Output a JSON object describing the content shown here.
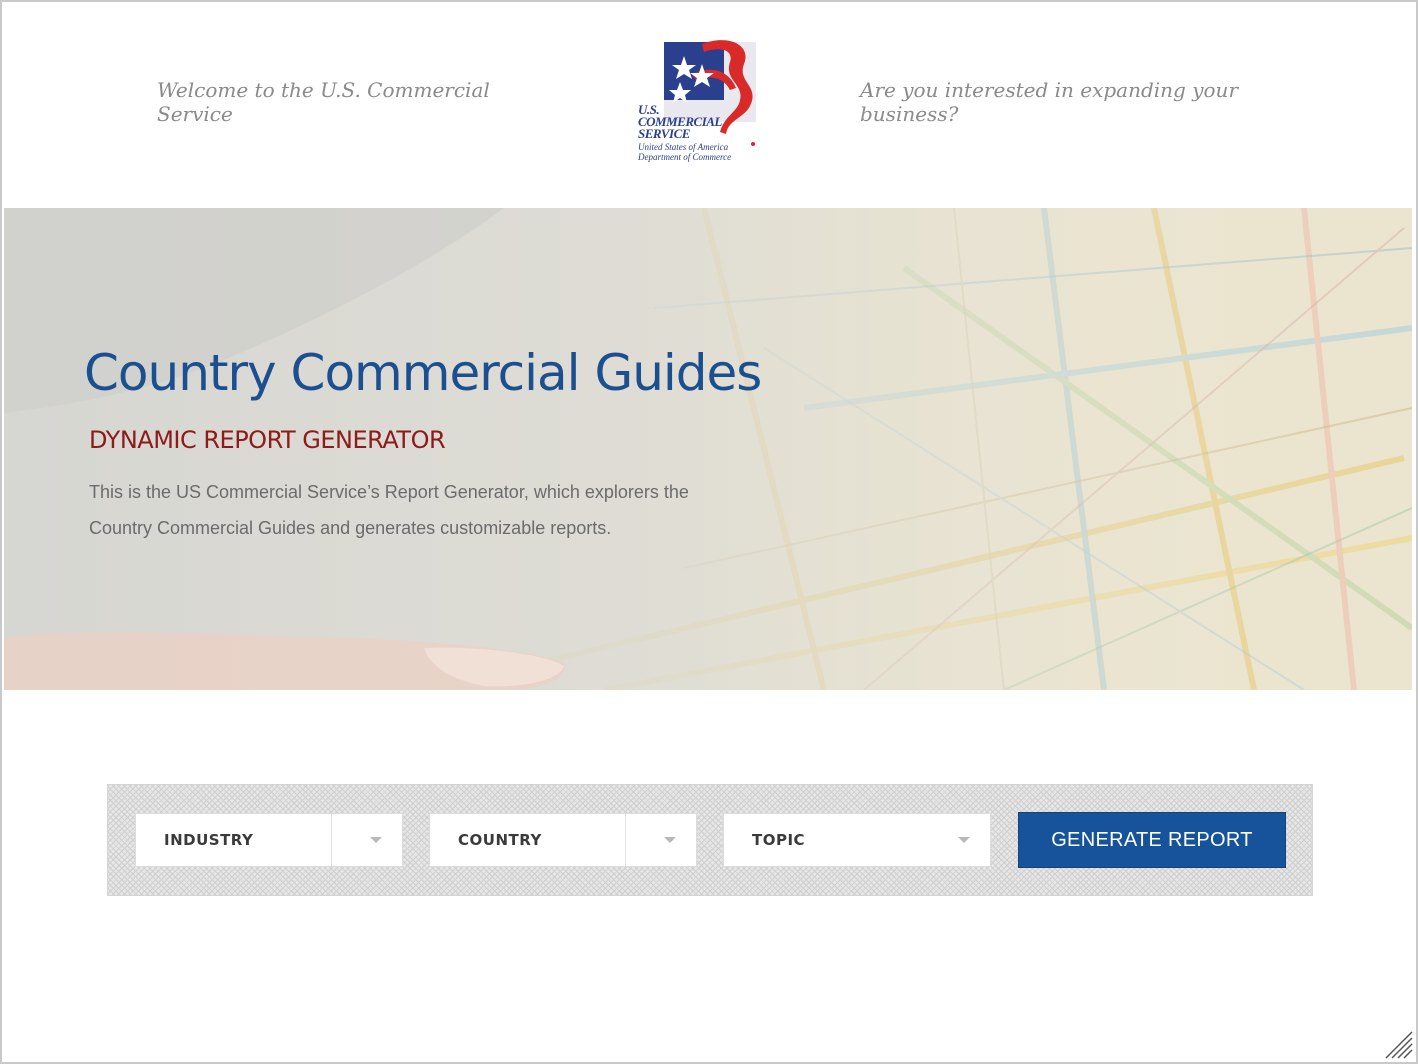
{
  "header": {
    "welcome_text": "Welcome to the U.S. Commercial Service",
    "question_text": "Are you interested in expanding your business?",
    "logo": {
      "line1": "U.S.",
      "line2": "COMMERCIAL",
      "line3": "SERVICE",
      "sub1": "United States of America",
      "sub2": "Department of Commerce"
    }
  },
  "hero": {
    "title": "Country Commercial Guides",
    "subtitle": "DYNAMIC REPORT GENERATOR",
    "description": "This is the US Commercial Service’s Report Generator, which explorers the Country Commercial Guides and generates customizable reports."
  },
  "controls": {
    "industry_label": "INDUSTRY",
    "country_label": "COUNTRY",
    "topic_label": "TOPIC",
    "generate_label": "GENERATE REPORT"
  },
  "colors": {
    "title_blue": "#1c4f8f",
    "subtitle_red": "#8e1a1a",
    "button_blue": "#17539a"
  }
}
